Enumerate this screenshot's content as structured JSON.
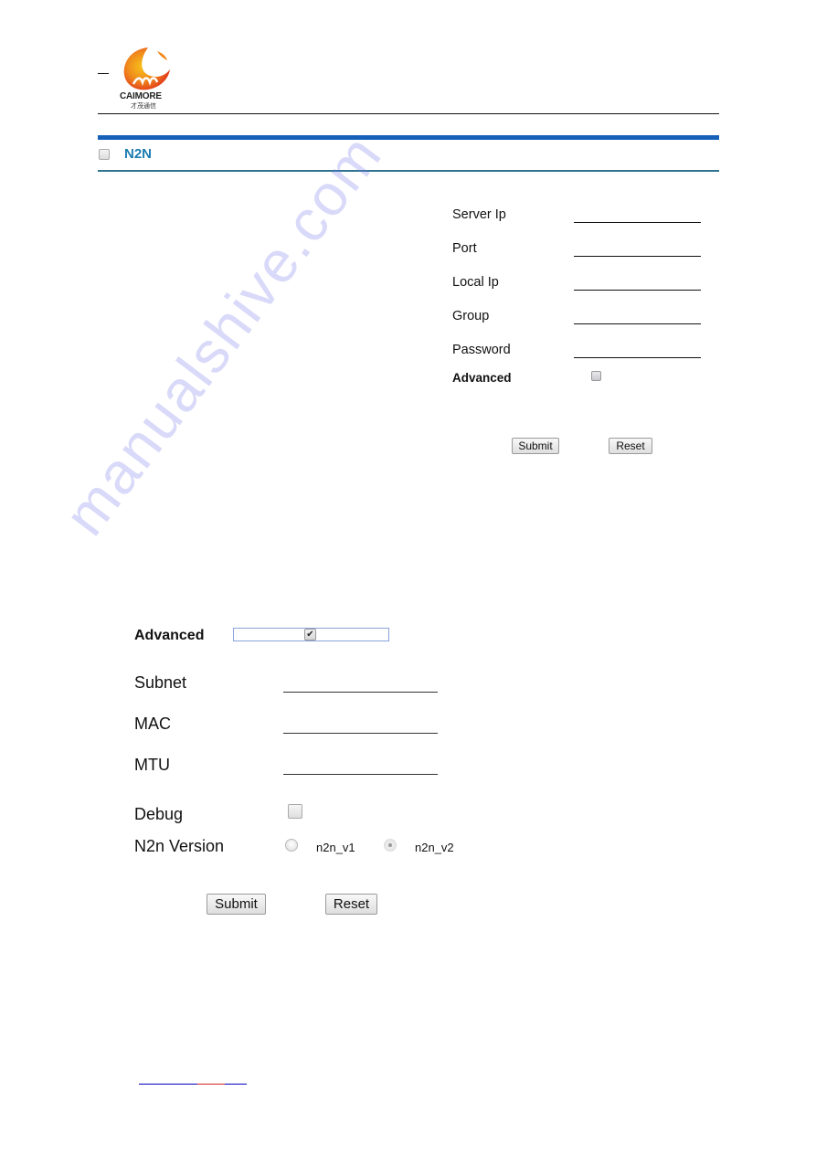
{
  "header": {
    "brand": "CAIMORE",
    "brand_sub": "才茂通信",
    "brand_colors": {
      "orange": "#f08a1c",
      "red": "#e23a1a",
      "yellow": "#f7c21a"
    },
    "bar_color": "#1560b8",
    "rule_color": "#2e7490"
  },
  "section": {
    "title": "N2N",
    "title_color": "#1b7bb0",
    "checked": false
  },
  "form_basic": {
    "fields": [
      {
        "label": "Server Ip",
        "value": ""
      },
      {
        "label": "Port",
        "value": ""
      },
      {
        "label": "Local Ip",
        "value": ""
      },
      {
        "label": "Group",
        "value": ""
      },
      {
        "label": "Password",
        "value": ""
      }
    ],
    "advanced_label": "Advanced",
    "advanced_checked": false,
    "submit_label": "Submit",
    "reset_label": "Reset"
  },
  "form_advanced": {
    "advanced_label": "Advanced",
    "advanced_checked": true,
    "check_glyph": "✔",
    "fields": [
      {
        "label": "Subnet",
        "value": ""
      },
      {
        "label": "MAC",
        "value": ""
      },
      {
        "label": "MTU",
        "value": ""
      }
    ],
    "debug_label": "Debug",
    "debug_checked": false,
    "version_label": "N2n Version",
    "version_options": [
      {
        "label": "n2n_v1",
        "selected": false
      },
      {
        "label": "n2n_v2",
        "selected": true
      }
    ],
    "submit_label": "Submit",
    "reset_label": "Reset"
  },
  "watermark": "manualshive.com"
}
